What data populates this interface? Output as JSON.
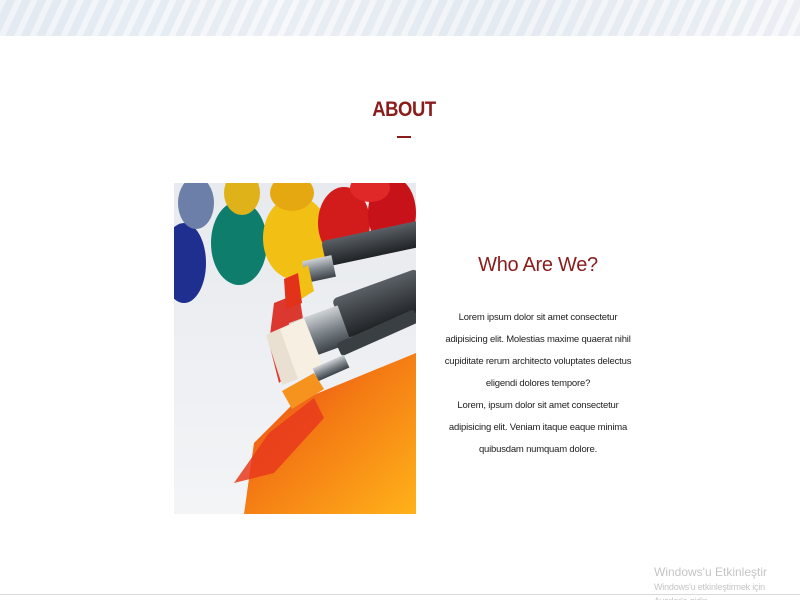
{
  "about": {
    "heading": "ABOUT",
    "image_alt": "Paint brushes with colorful paint tubes",
    "subheading": "Who Are We?",
    "paragraphs": [
      "Lorem ipsum dolor sit amet consectetur adipisicing elit. Molestias maxime quaerat nihil cupiditate rerum architecto voluptates delectus eligendi dolores tempore?",
      "Lorem, ipsum dolor sit amet consectetur adipisicing elit. Veniam itaque eaque minima quibusdam numquam dolore."
    ]
  },
  "watermark": {
    "title": "Windows'u Etkinleştir",
    "subtitle": "Windows'u etkinleştirmek için Ayarlar'a gidin."
  },
  "colors": {
    "accent": "#8b1c1c",
    "text": "#222222"
  }
}
